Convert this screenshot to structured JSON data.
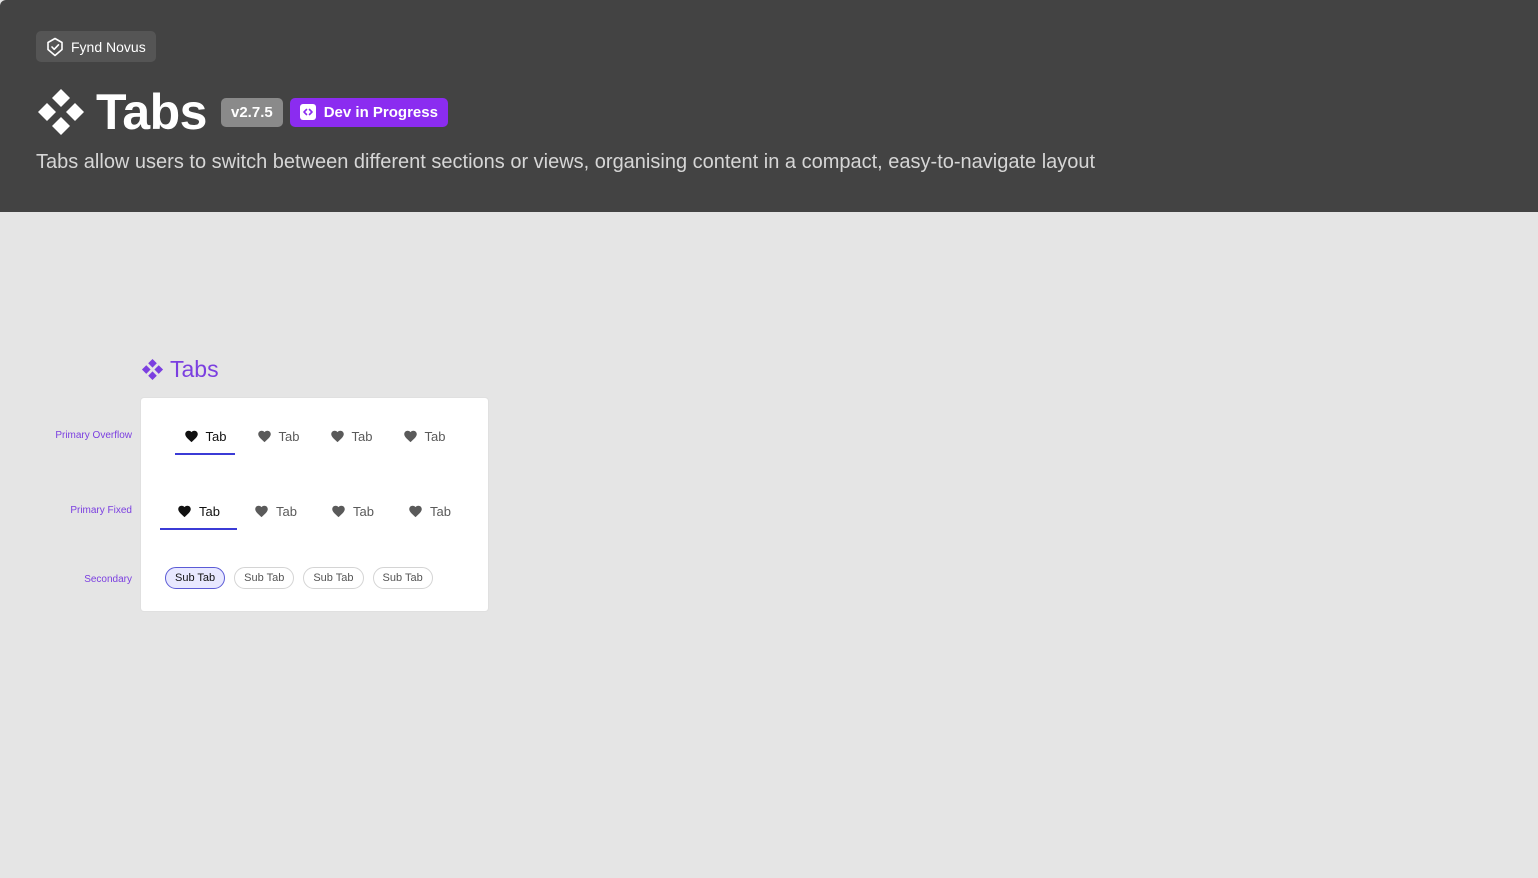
{
  "header": {
    "brand": "Fynd Novus",
    "title": "Tabs",
    "version": "v2.7.5",
    "status": "Dev in Progress",
    "description": "Tabs allow users to switch between different sections or views, organising content in a compact, easy-to-navigate layout",
    "colors": {
      "background": "#434343",
      "status": "#8b2cf0",
      "version": "#8a8a8a"
    }
  },
  "showcase": {
    "title": "Tabs",
    "rows": [
      {
        "label": "Primary Overflow",
        "variant": "primary-overflow",
        "tabs": [
          {
            "label": "Tab",
            "icon": "heart-icon",
            "active": true
          },
          {
            "label": "Tab",
            "icon": "heart-icon",
            "active": false
          },
          {
            "label": "Tab",
            "icon": "heart-icon",
            "active": false
          },
          {
            "label": "Tab",
            "icon": "heart-icon",
            "active": false
          }
        ]
      },
      {
        "label": "Primary Fixed",
        "variant": "primary-fixed",
        "tabs": [
          {
            "label": "Tab",
            "icon": "heart-icon",
            "active": true
          },
          {
            "label": "Tab",
            "icon": "heart-icon",
            "active": false
          },
          {
            "label": "Tab",
            "icon": "heart-icon",
            "active": false
          },
          {
            "label": "Tab",
            "icon": "heart-icon",
            "active": false
          }
        ]
      },
      {
        "label": "Secondary",
        "variant": "secondary",
        "tabs": [
          {
            "label": "Sub Tab",
            "active": true
          },
          {
            "label": "Sub Tab",
            "active": false
          },
          {
            "label": "Sub Tab",
            "active": false
          },
          {
            "label": "Sub Tab",
            "active": false
          }
        ]
      }
    ],
    "colors": {
      "accent": "#7b3fe0",
      "indicator": "#3b3bd6"
    }
  }
}
